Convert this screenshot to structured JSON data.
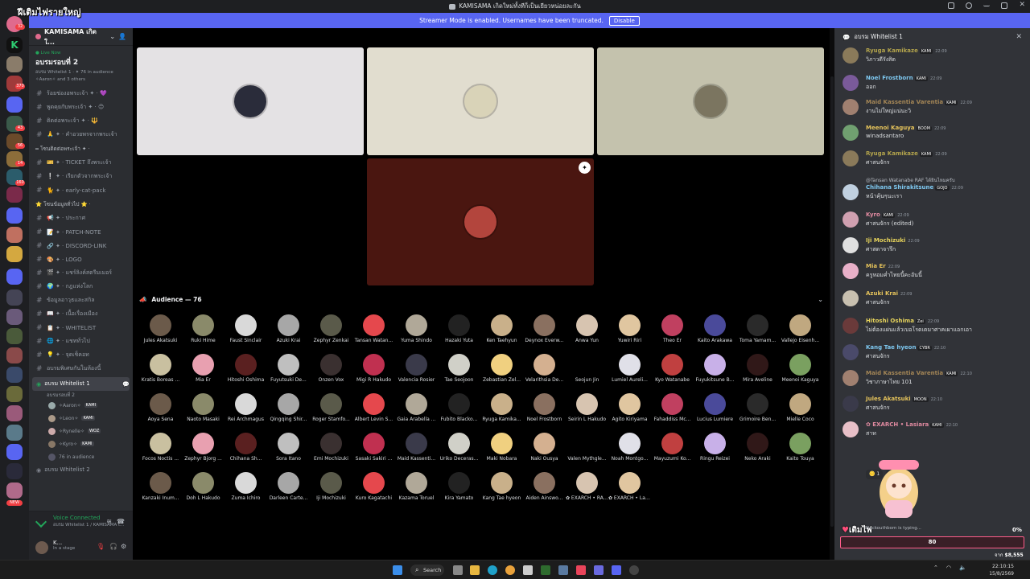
{
  "window": {
    "title": "KAMISAMA เกิดใหม่ทั้งทีก็เป็นเยียวหน่อยละกัน",
    "overlay_tag": "ฝีเติมไฟรายใหญ่"
  },
  "banner": {
    "text": "Streamer Mode is enabled. Usernames have been truncated.",
    "button": "Disable"
  },
  "rail_badges": [
    "32",
    "370",
    "43",
    "56",
    "14",
    "160",
    "NEW"
  ],
  "server": {
    "name": "KAMISAMA เกิดใ...",
    "live_label": "● Live Now",
    "stage_name": "อบรมรอบที่ 2",
    "stage_sub": "อบรม Whitelist 1 · ✦ 76 in audience",
    "stage_members": "✧Aaron✧ and 3 others"
  },
  "channels": [
    {
      "type": "text",
      "label": "ร้อยช่องอพระเจ้า ✦ · 💜"
    },
    {
      "type": "text",
      "label": "พูดคุยกับพระเจ้า ✦ · 😊"
    },
    {
      "type": "text",
      "label": "ติดต่อพระเจ้า ✦ · 🔱"
    },
    {
      "type": "text",
      "label": "🙏 ✦ · คำอวยพรจากพระเจ้า"
    },
    {
      "type": "cat",
      "label": "═ โซนติดต่อพระเจ้า ✦ ·"
    },
    {
      "type": "text",
      "label": "🎫 ✦ · TICKET ถึงพระเจ้า"
    },
    {
      "type": "text",
      "label": "❕ ✦ · เรียกตัวจากพระเจ้า"
    },
    {
      "type": "text",
      "label": "🐈 ✦ · early-cat-pack"
    },
    {
      "type": "cat",
      "label": "⭐ โซนข้อมูลทั่วไป ⭐ ·"
    },
    {
      "type": "text",
      "label": "📢 ✦ · ประกาศ"
    },
    {
      "type": "text",
      "label": "📝 ✦ · PATCH-NOTE"
    },
    {
      "type": "text",
      "label": "🔗 ✦ · DISCORD-LINK"
    },
    {
      "type": "text",
      "label": "🎨 ✦ · LOGO"
    },
    {
      "type": "text",
      "label": "🎬 ✦ · แชร์ลิงค์สตรีมเมอร์"
    },
    {
      "type": "text",
      "label": "🌍 ✦ · กฎแห่งโลก"
    },
    {
      "type": "text",
      "label": "ข้อมูลอาวุธและสกิล"
    },
    {
      "type": "text",
      "label": "📖 ✦ · เนื้อเรื่องเมือง"
    },
    {
      "type": "text",
      "label": "📋 ✦ · WHITELIST"
    },
    {
      "type": "text",
      "label": "🌐 ✦ · แชททั่วไป"
    },
    {
      "type": "text",
      "label": "💡 ✦ · จุดเช็คอท"
    },
    {
      "type": "text",
      "label": "อบรมพิเศษกันในห้องนี้"
    }
  ],
  "voice_channel": {
    "name": "อบรม Whitelist 1",
    "sub": "อบรมรอบที่ 2"
  },
  "voice_members": [
    {
      "name": "✧Aaron✧",
      "tag": "KAMI"
    },
    {
      "name": "✧Leon✧",
      "tag": "KAMI"
    },
    {
      "name": "✧Rynelle✧",
      "tag": "WOZ"
    },
    {
      "name": "✧Kyro✧",
      "tag": "KAMI"
    },
    {
      "name": "76 in audience",
      "tag": ""
    }
  ],
  "voice_channel2": "อบรม Whitelist 2",
  "voice_status": {
    "label": "Voice Connected",
    "sub": "อบรม Whitelist 1 / KAMISAMA เ..."
  },
  "user": {
    "name": "K...",
    "status": "In a stage"
  },
  "speakers": [
    {
      "color": "#e4e2e4",
      "avatar": "#2a2c3a"
    },
    {
      "color": "#e1ddcf",
      "avatar": "#d9d3b8"
    },
    {
      "color": "#c4c2ad",
      "avatar": "#7b7560"
    },
    {
      "color": "#4a1610",
      "avatar": "#b3453d"
    }
  ],
  "audience": {
    "title": "Audience — 76",
    "members": [
      "Jules Akatsuki",
      "Ruki Hime",
      "Faust Sinclair",
      "Azuki Krai",
      "Zephyr Zenkai",
      "Tansan Watan...",
      "Yuma Shindo",
      "Hazaki Yuta",
      "Ken Taehyun",
      "Deynox Everw...",
      "Anwa Yun",
      "Yuwiri Riri",
      "Theo Er",
      "Kaito Arakawa",
      "Toma Yamam...",
      "Vallejo Eisenh...",
      "Kratis Boreas ...",
      "Mia Er",
      "Hitoshi Oshima",
      "Fuyutsuki De...",
      "Onzen Vox",
      "Migi R Hakudo",
      "Valencia Rosier",
      "Tae Seojoon",
      "Zebastian Zel...",
      "Velarithsia De...",
      "Seojun Jin",
      "Lumiel Aureli...",
      "Kyo Watanabe",
      "Fuyukitsune B...",
      "Mira Aveline",
      "Meenoi Kaguya",
      "Aoya Sena",
      "Naoto Masaki",
      "Rei Archmagus",
      "Qingqing Shir...",
      "Roger Stamfo...",
      "Albert Levin S...",
      "Gaia Arabella ...",
      "Fubito Blacko...",
      "Ryuga Kamika...",
      "Noel Frostborn",
      "Seirin L Hakudo",
      "Agito Kiriyama",
      "Fahaddiss Mc...",
      "Lucius Lumiere",
      "Grimoire Ben...",
      "Mielle Coco",
      "Focos Noctis ...",
      "Zephyr Bjorg ...",
      "Chihana Sh...",
      "Sora Itano",
      "Emi Mochizuki",
      "Sasaki Sakiri ...",
      "Maid Kassenti...",
      "Uriko Deceras...",
      "Maki Nobara",
      "Naki Ousya",
      "Valen Mythgle...",
      "Noah Montgo...",
      "Mayuzumi Ko...",
      "Ringu Reizei",
      "Neko Araki",
      "Kaito Touya",
      "Kanzaki Inum...",
      "Doh L Hakudo",
      "Zuma Ichiro",
      "Darleen Carte...",
      "Iji Mochizuki",
      "Kuro Kagatachi",
      "Kazama Toruel",
      "Kira Yamato",
      "Kang Tae hyeon",
      "Aiden Ainswo...",
      "✿ EXARCH • RAI...",
      "✿ EXARCH • Las..."
    ]
  },
  "chat": {
    "title": "อบรม Whitelist 1",
    "messages": [
      {
        "name": "Ryuga Kamikaze",
        "color": "#b3a44c",
        "tag": "KAMI",
        "time": "22:09",
        "text": "วิภาวดีรังสิต",
        "reply": ""
      },
      {
        "name": "Noel Frostborn",
        "color": "#7ec8f0",
        "tag": "KAMI",
        "time": "22:09",
        "text": "ออก",
        "reply": ""
      },
      {
        "name": "Maid Kassentia Varentia",
        "color": "#a48656",
        "tag": "KAMI",
        "time": "22:09",
        "text": "งานไม่ใหญ่แน่นะวิ",
        "reply": ""
      },
      {
        "name": "Meenoi Kaguya",
        "color": "#e5c35b",
        "tag": "BOOM",
        "time": "22:09",
        "text": "winadsantaro",
        "reply": ""
      },
      {
        "name": "Ryuga Kamikaze",
        "color": "#b3a44c",
        "tag": "KAMI",
        "time": "22:09",
        "text": "ศาสนจักร",
        "reply": ""
      },
      {
        "name": "Chihana Shirakitsune",
        "color": "#7ec8f0",
        "tag": "GOJO",
        "time": "22:09",
        "text": "หน้าคุ้นๆนะเรา",
        "reply": "@Tansan Watanabe RAF ได้ยินไหมครับ"
      },
      {
        "name": "Kyro",
        "color": "#e08aa0",
        "tag": "KAMI",
        "time": "22:09",
        "text": "ศาสนจักร (edited)",
        "reply": ""
      },
      {
        "name": "Iji Mochizuki",
        "color": "#e5d25b",
        "tag": "",
        "time": "22:09",
        "text": "ศาสดาจารึก",
        "reply": ""
      },
      {
        "name": "Mia Er",
        "color": "#e5c35b",
        "tag": "",
        "time": "22:09",
        "text": "ครูหอมค่ำไทยนี้คะอันนี้",
        "reply": ""
      },
      {
        "name": "Azuki Krai",
        "color": "#e5c35b",
        "tag": "",
        "time": "22:09",
        "text": "ศาสนจักร",
        "reply": ""
      },
      {
        "name": "Hitoshi Oshima",
        "color": "#e5d25b",
        "tag": "Zei",
        "time": "22:09",
        "text": "ไม่ต้องแผ่นแล้วเบอโรดเดมาศาคเผาแอกเอา",
        "reply": ""
      },
      {
        "name": "Kang Tae hyeon",
        "color": "#7ec8f0",
        "tag": "CYBR",
        "time": "22:10",
        "text": "ศาสนจักร",
        "reply": ""
      },
      {
        "name": "Maid Kassentia Varentia",
        "color": "#a48656",
        "tag": "KAMI",
        "time": "22:10",
        "text": "วิชาภาษาไทย 101",
        "reply": ""
      },
      {
        "name": "Jules Akatsuki",
        "color": "#e5c35b",
        "tag": "MOON",
        "time": "22:10",
        "text": "ศาสนจักร",
        "reply": ""
      },
      {
        "name": "✿ EXARCH • Lasiara",
        "color": "#e08aa0",
        "tag": "KAMI",
        "time": "22:10",
        "text": "สาท",
        "reply": ""
      }
    ],
    "reactions": [
      "🪙 1",
      "😶"
    ],
    "typing": "Blackouthbom is typing..."
  },
  "donation": {
    "label": "เติมไฟ",
    "percent": "0%",
    "current": "80",
    "goal_prefix": "จาก",
    "goal": "$8,555"
  },
  "taskbar": {
    "search": "Search",
    "time": "22:10:15",
    "date": "15/8/2569"
  }
}
